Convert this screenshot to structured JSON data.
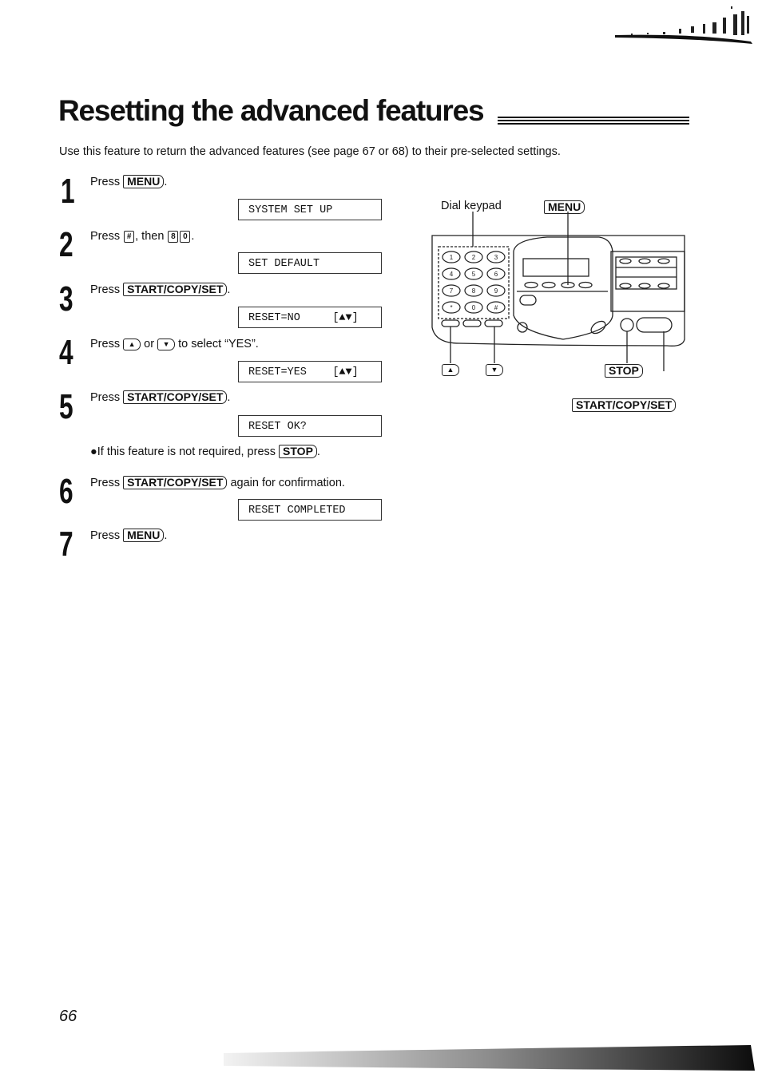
{
  "page": {
    "title": "Resetting the advanced features",
    "intro": "Use this feature to return the advanced features (see page 67 or 68) to their pre-selected settings.",
    "page_number": "66"
  },
  "steps": [
    {
      "num": "1",
      "prefix": "Press",
      "key": "MENU",
      "suffix": ".",
      "display": "SYSTEM SET UP"
    },
    {
      "num": "2",
      "prefix": "Press",
      "key_hash": "#",
      "mid": ", then",
      "key_8": "8",
      "key_0": "0",
      "suffix": ".",
      "display": "SET DEFAULT"
    },
    {
      "num": "3",
      "prefix": "Press",
      "key": "START/COPY/SET",
      "suffix": ".",
      "display": "RESET=NO     [▲▼]"
    },
    {
      "num": "4",
      "prefix": "Press",
      "key_up": "▲",
      "mid": "or",
      "key_down": "▼",
      "suffix": "to select “YES”.",
      "display": "RESET=YES    [▲▼]"
    },
    {
      "num": "5",
      "prefix": "Press",
      "key": "START/COPY/SET",
      "suffix": ".",
      "display": "RESET OK?",
      "note_prefix": "●If this feature is not required, press",
      "note_key": "STOP",
      "note_suffix": "."
    },
    {
      "num": "6",
      "prefix": "Press",
      "key": "START/COPY/SET",
      "suffix": "again for confirmation.",
      "display": "RESET COMPLETED"
    },
    {
      "num": "7",
      "prefix": "Press",
      "key": "MENU",
      "suffix": "."
    }
  ],
  "diagram": {
    "label_dial_keypad": "Dial keypad",
    "label_menu": "MENU",
    "label_up": "▲",
    "label_down": "▼",
    "label_stop": "STOP",
    "label_start": "START/COPY/SET",
    "keypad": [
      "1",
      "2",
      "3",
      "4",
      "5",
      "6",
      "7",
      "8",
      "9",
      "*",
      "0",
      "#"
    ]
  }
}
